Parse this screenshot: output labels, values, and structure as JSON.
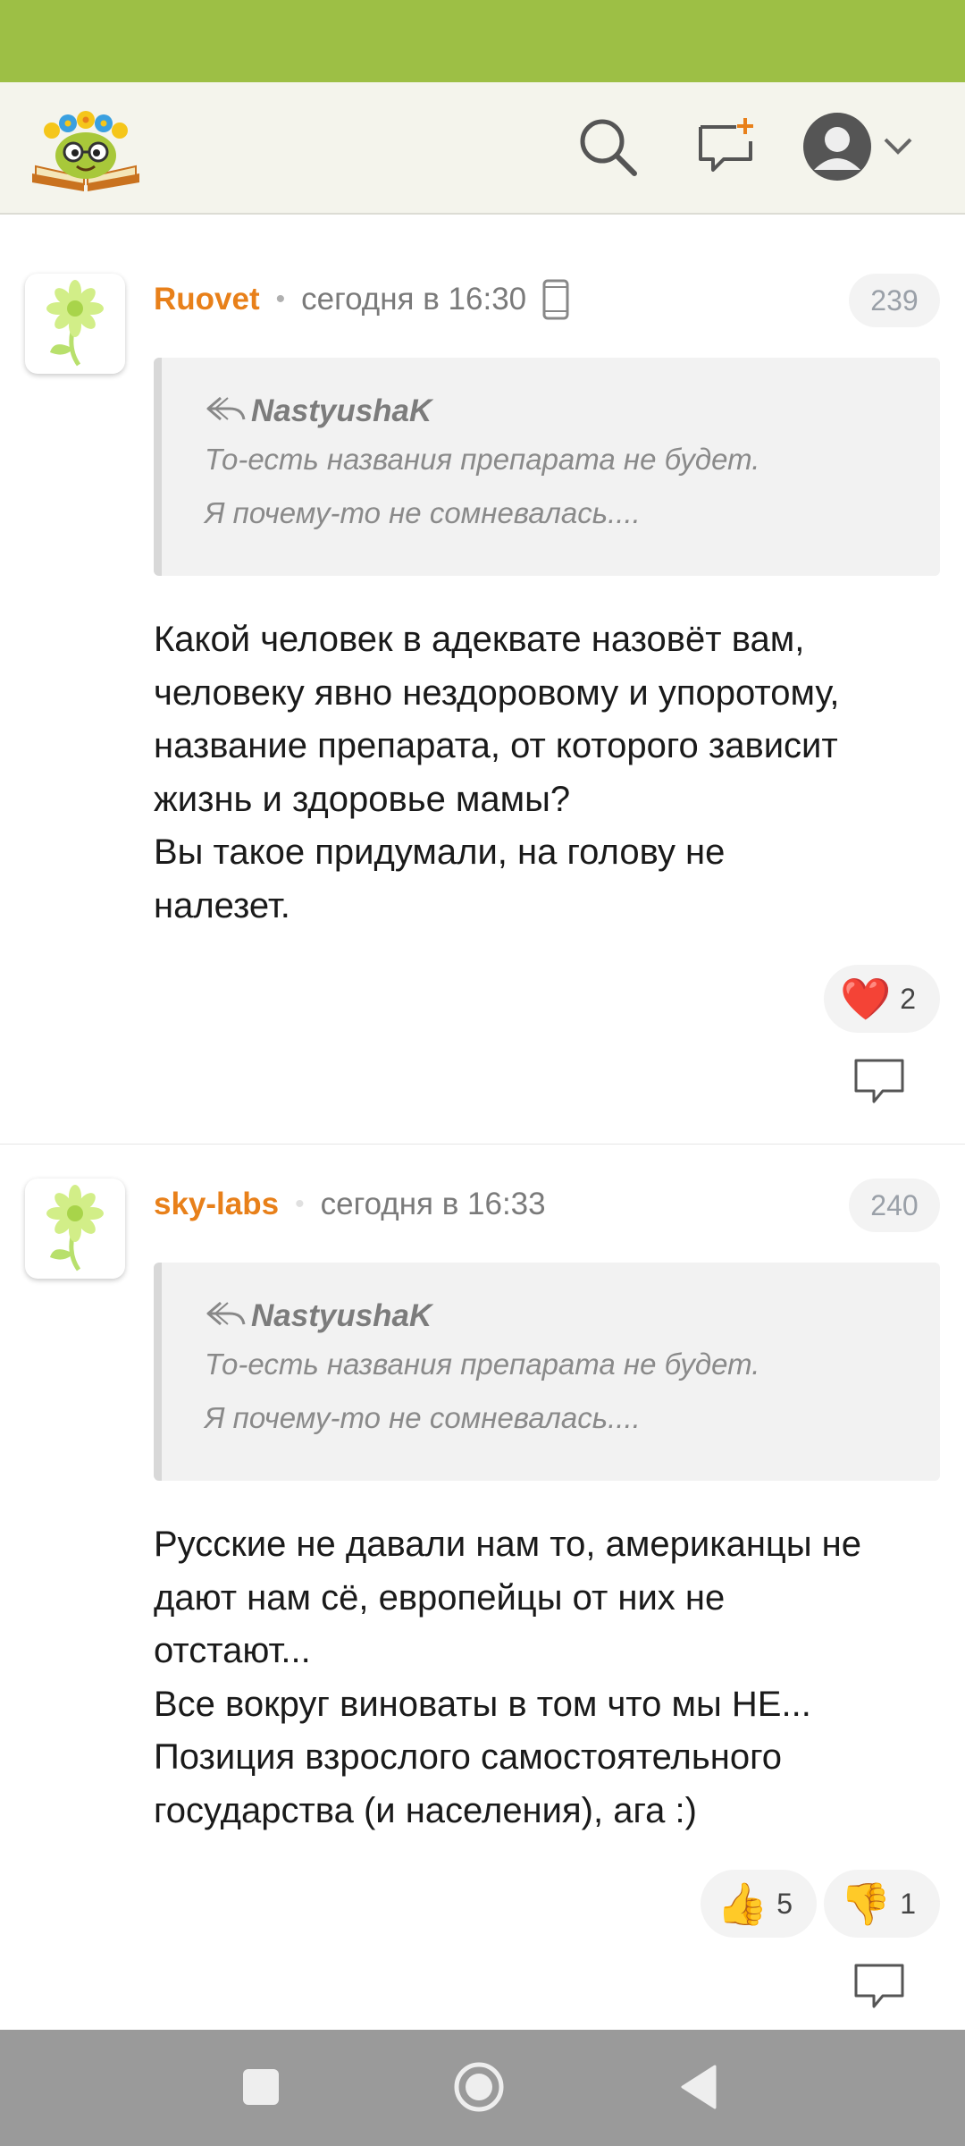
{
  "header": {
    "logo": "site-logo-smiling-book-with-flowers",
    "icons": {
      "search": "search-icon",
      "new_message": "new-message-icon",
      "profile": "user-avatar-icon",
      "dropdown": "chevron-down-icon"
    }
  },
  "comments": [
    {
      "author": "Ruovet",
      "separator": "•",
      "time": "сегодня в 16:30",
      "device": "mobile-phone-icon",
      "number": "239",
      "quote": {
        "author": "NastyushaK",
        "lines": [
          "То-есть названия препарата не будет.",
          "Я почему-то не сомневалась...."
        ]
      },
      "text_lines": [
        "Какой человек в адеквате назовёт вам,",
        "человеку явно нездоровому и упоротому,",
        "название препарата, от которого зависит",
        "жизнь и здоровье мамы?",
        "Вы такое придумали, на голову не",
        "налезет."
      ],
      "reactions": [
        {
          "icon": "heart-icon",
          "glyph": "❤️",
          "count": "2"
        }
      ]
    },
    {
      "author": "sky-labs",
      "separator": "•",
      "time": "сегодня в 16:33",
      "number": "240",
      "quote": {
        "author": "NastyushaK",
        "lines": [
          "То-есть названия препарата не будет.",
          "Я почему-то не сомневалась...."
        ]
      },
      "text_lines": [
        "Русские не давали нам то, американцы не",
        "дают нам сё, европейцы от них не",
        "отстают...",
        "Все вокруг виноваты в том что мы НЕ...",
        "Позиция взрослого самостоятельного",
        "государства (и населения), ага :)"
      ],
      "reactions": [
        {
          "icon": "thumbs-up-icon",
          "glyph": "👍",
          "count": "5"
        },
        {
          "icon": "thumbs-down-icon",
          "glyph": "👎",
          "count": "1"
        }
      ]
    }
  ],
  "colors": {
    "status_bar": "#9dbf45",
    "header_bg": "#f4f4ec",
    "author": "#e8801a",
    "nav_bar": "#9a9a9a"
  }
}
